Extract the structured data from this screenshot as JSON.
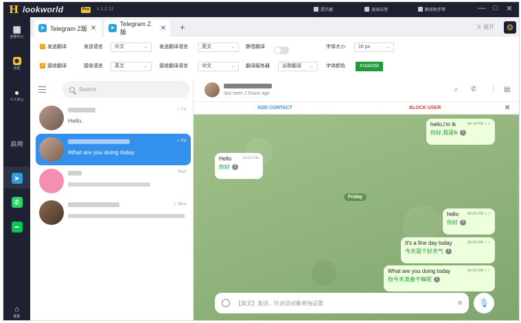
{
  "titlebar": {
    "logo_h": "H",
    "logo_word": "lookworld",
    "logo_badge": "Pro",
    "version": "v 1.2.11",
    "items": [
      "提示器",
      "退出应用",
      "翻译助手等"
    ],
    "win_buttons": [
      "—",
      "□",
      "✕"
    ]
  },
  "sidebar": {
    "items": [
      {
        "icon": "grid-icon",
        "label": "应用中心"
      },
      {
        "icon": "bot-icon",
        "label": "云控"
      },
      {
        "icon": "person-icon",
        "label": "个人中心"
      },
      {
        "icon": "",
        "label": "启用"
      },
      {
        "icon": "telegram-icon",
        "label": ""
      },
      {
        "icon": "whatsapp-icon",
        "label": ""
      },
      {
        "icon": "line-icon",
        "label": ""
      },
      {
        "icon": "help-icon",
        "label": "帮助"
      }
    ]
  },
  "tabs": [
    {
      "label": "Telegram Z版",
      "close": "✕"
    },
    {
      "label": "Telegram Z版",
      "close": "✕"
    }
  ],
  "tab_add": "+",
  "expand_label": "展开",
  "settings": {
    "row1": {
      "send_translate": "发送翻译",
      "send_lang_label": "发送语言",
      "send_lang": "中文",
      "send_target_label": "发送翻译语言",
      "send_target": "英文",
      "silent_label": "静音翻译",
      "font_size_label": "字体大小",
      "font_size": "16 px"
    },
    "row2": {
      "recv_translate": "接收翻译",
      "recv_lang_label": "接收语言",
      "recv_lang": "英文",
      "recv_target_label": "接收翻译语言",
      "recv_target": "中文",
      "server_label": "翻译服务器",
      "server": "谷歌翻译",
      "font_color_label": "字体颜色",
      "font_color": "#18A058"
    }
  },
  "chatlist": {
    "search_placeholder": "Search",
    "items": [
      {
        "time": "✓ Fri",
        "message": "Hello.",
        "active": false
      },
      {
        "time": "✓ Fri",
        "message": "What are you doing today",
        "active": true
      },
      {
        "time": "Wed",
        "message": "",
        "active": false
      },
      {
        "time": "✓ Mon",
        "message": "",
        "active": false
      }
    ]
  },
  "chat": {
    "status": "last seen 2 hours ago",
    "add_contact": "ADD CONTACT",
    "block_user": "BLOCK USER",
    "day_badge": "Friday",
    "messages": [
      {
        "dir": "out",
        "text": "hello,i'm lk",
        "translation": "你好,我是lk",
        "time": "04:14 PM ✓✓"
      },
      {
        "dir": "in",
        "text": "Hello",
        "translation": "你好",
        "time": "04:16 PM"
      },
      {
        "dir": "out",
        "text": "hello",
        "translation": "你好",
        "time": "06:06 PM ✓✓"
      },
      {
        "dir": "out",
        "text": "It's a fine day today",
        "translation": "今天是个好天气",
        "time": "06:06 PM ✓✓"
      },
      {
        "dir": "out",
        "text": "What are you doing today",
        "translation": "你今天准备干嘛呢",
        "time": "06:09 PM ✓✓"
      }
    ],
    "composer_placeholder": "【英文】发送，针对该对象单独设置"
  }
}
